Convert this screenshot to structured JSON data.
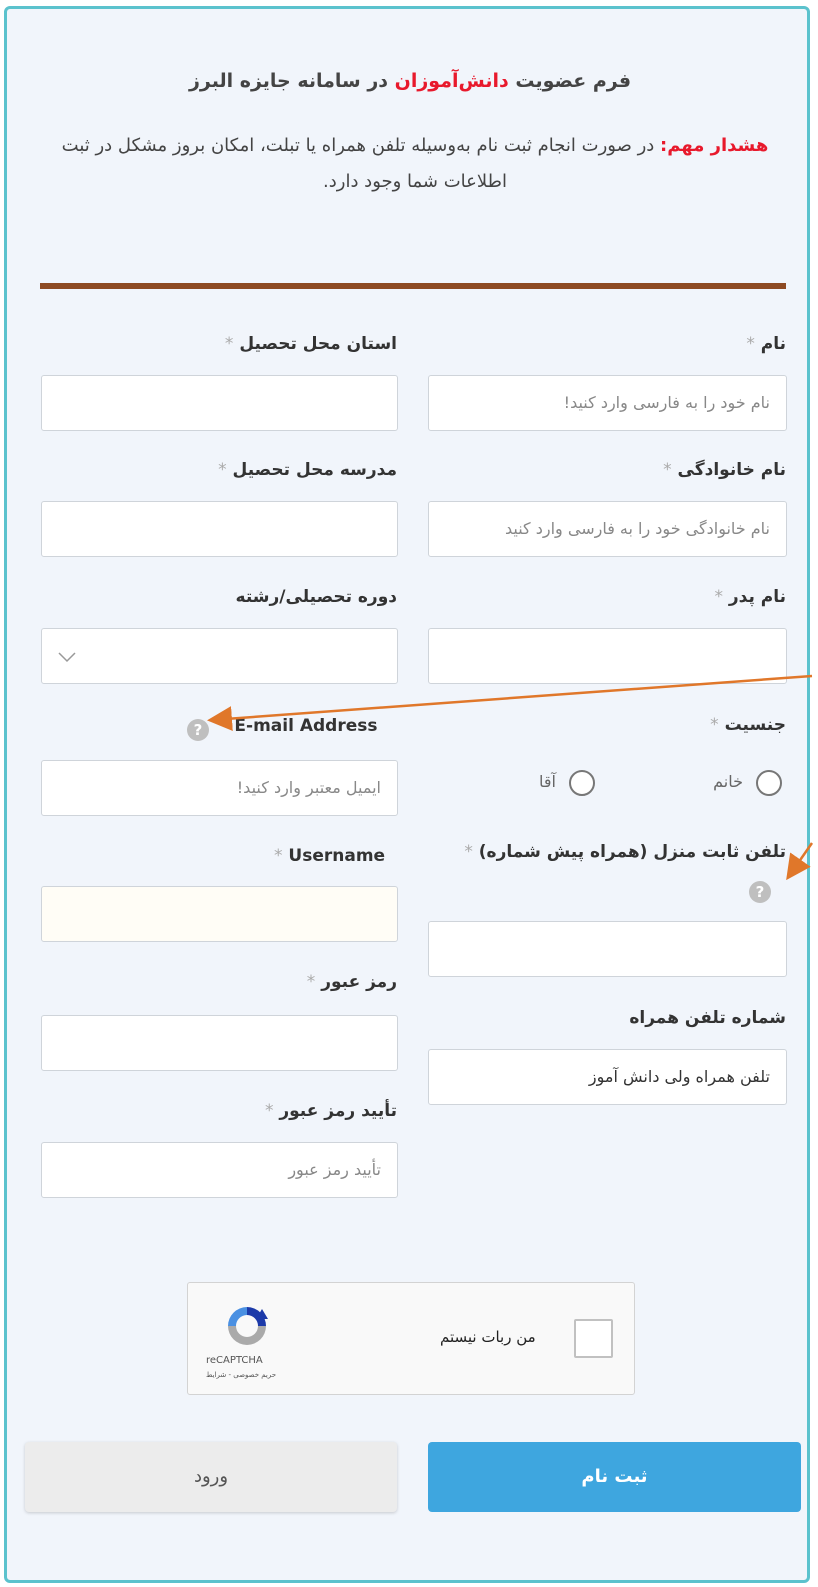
{
  "header": {
    "title_prefix": "فرم عضویت ",
    "title_highlight": "دانش‌آموزان",
    "title_suffix": " در سامانه جایزه البرز",
    "warning_label": "هشدار مهم:",
    "warning_text": " در صورت انجام ثبت نام به‌وسیله تلفن همراه یا تبلت، امکان بروز مشکل در ثبت اطلاعات شما وجود دارد."
  },
  "form": {
    "first_name": {
      "label": "نام",
      "required": "*",
      "placeholder": "نام خود را به فارسی وارد کنید!"
    },
    "last_name": {
      "label": "نام خانوادگی",
      "required": "*",
      "placeholder": "نام خانوادگی خود را به فارسی وارد کنید"
    },
    "father_name": {
      "label": "نام پدر",
      "required": "*"
    },
    "gender": {
      "label": "جنسیت",
      "required": "*",
      "options": [
        "خانم",
        "آقا"
      ]
    },
    "home_phone": {
      "label": "تلفن ثابت منزل (همراه پیش شماره)",
      "required": "*"
    },
    "mobile": {
      "label": "شماره تلفن همراه",
      "placeholder": "تلفن همراه ولی دانش آموز"
    },
    "province": {
      "label": "استان محل تحصیل",
      "required": "*"
    },
    "school": {
      "label": "مدرسه محل تحصیل",
      "required": "*"
    },
    "grade": {
      "label": "دوره تحصیلی/رشته"
    },
    "email": {
      "label": "E-mail Address",
      "required": "*",
      "placeholder": "ایمیل معتبر وارد کنید!"
    },
    "username": {
      "label": "Username",
      "required": "*"
    },
    "password": {
      "label": "رمز عبور",
      "required": "*"
    },
    "confirm_password": {
      "label": "تأیید رمز عبور",
      "required": "*",
      "placeholder": "تأیید رمز عبور"
    },
    "help_icon_text": "?"
  },
  "captcha": {
    "checkbox_label": "من ربات نیستم",
    "brand": "reCAPTCHA",
    "links": "حریم خصوصی - شرایط"
  },
  "buttons": {
    "register": "ثبت نام",
    "login": "ورود"
  }
}
